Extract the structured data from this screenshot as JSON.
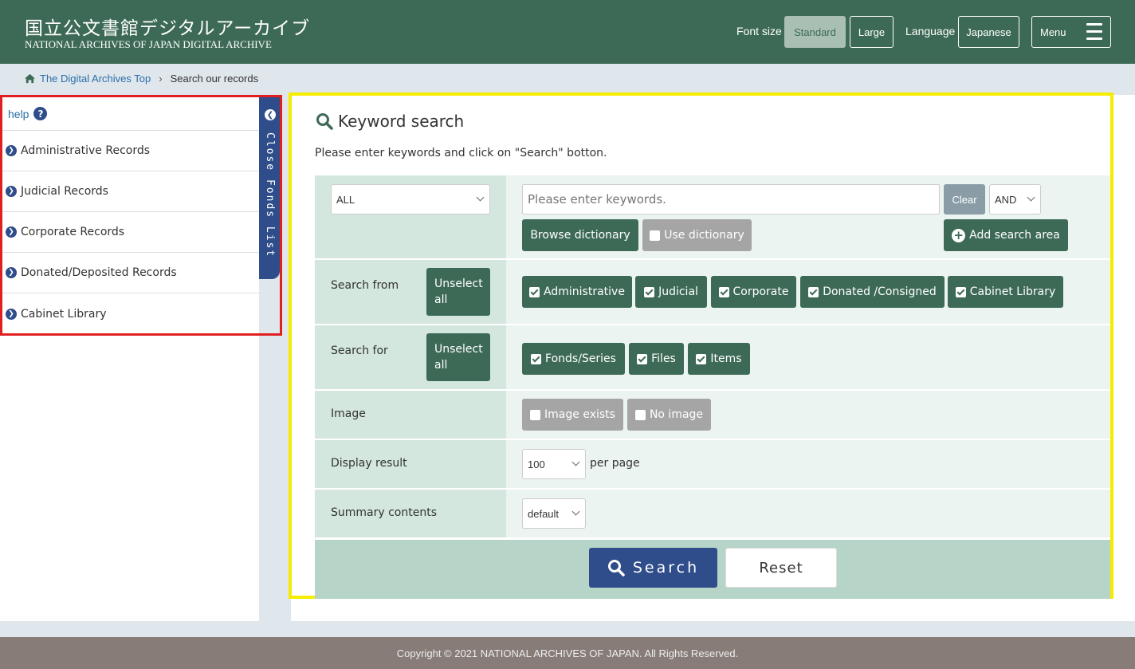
{
  "header": {
    "logo_jp": "国立公文書館デジタルアーカイブ",
    "logo_en": "NATIONAL ARCHIVES OF JAPAN  DIGITAL ARCHIVE",
    "font_size_label": "Font size",
    "font_standard": "Standard",
    "font_large": "Large",
    "language_label": "Language",
    "language_value": "Japanese",
    "menu_label": "Menu"
  },
  "breadcrumb": {
    "home": "The Digital Archives Top",
    "separator": "›",
    "current": "Search our records"
  },
  "sidebar": {
    "help": "help",
    "close_tab": "Close Fonds List",
    "items": [
      {
        "label": "Administrative Records"
      },
      {
        "label": "Judicial Records"
      },
      {
        "label": "Corporate Records"
      },
      {
        "label": "Donated/Deposited Records"
      },
      {
        "label": "Cabinet Library"
      }
    ]
  },
  "main": {
    "title": "Keyword search",
    "instruction": "Please enter keywords and click on \"Search\" botton.",
    "scope_select": "ALL",
    "keyword_placeholder": "Please enter keywords.",
    "clear": "Clear",
    "operator": "AND",
    "browse_dictionary": "Browse dictionary",
    "use_dictionary": "Use dictionary",
    "add_search_area": "Add search area",
    "search_from": {
      "label": "Search from",
      "unselect": "Unselect all",
      "options": [
        "Administrative",
        "Judicial",
        "Corporate",
        "Donated /Consigned",
        "Cabinet Library"
      ]
    },
    "search_for": {
      "label": "Search for",
      "unselect": "Unselect all",
      "options": [
        "Fonds/Series",
        "Files",
        "Items"
      ]
    },
    "image": {
      "label": "Image",
      "options": [
        "Image exists",
        "No image"
      ]
    },
    "display_result": {
      "label": "Display result",
      "value": "100",
      "suffix": "per page"
    },
    "summary": {
      "label": "Summary contents",
      "value": "default"
    },
    "search_button": "Search",
    "reset_button": "Reset"
  },
  "footer": {
    "copyright": "Copyright © 2021 NATIONAL ARCHIVES OF JAPAN. All Rights Reserved."
  },
  "colors": {
    "header": "#3d6a56",
    "primary_blue": "#2e4d8a",
    "highlight_yellow": "#f5ec00",
    "highlight_red": "#e02020"
  }
}
